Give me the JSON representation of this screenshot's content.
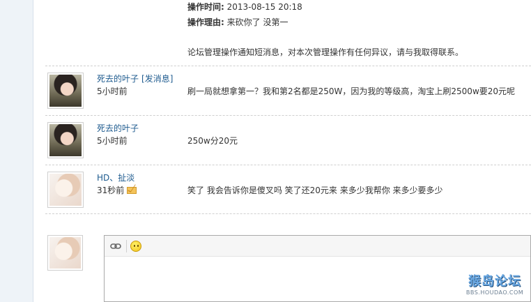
{
  "operation": {
    "time_label": "操作时间:",
    "time_value": "2013-08-15 20:18",
    "reason_label": "操作理由:",
    "reason_value": "来砍你了  没第一",
    "notice": "论坛管理操作通知短消息，对本次管理操作有任何异议，请与我取得联系。"
  },
  "comments": [
    {
      "author": "死去的叶子",
      "send_message": "[发消息]",
      "time": "5小时前",
      "content": "刷一局就想拿第一？我和第2名都是250W，因为我的等级高，淘宝上刷2500w要20元呢",
      "avatar": "girl-avatar"
    },
    {
      "author": "死去的叶子",
      "time": "5小时前",
      "content": "250w分20元",
      "avatar": "girl-avatar"
    },
    {
      "author": "HD、扯淡",
      "time": "31秒前",
      "content": "笑了  我会告诉你是傻叉吗              笑了还20元来  来多少我帮你 来多少要多少",
      "avatar": "doll-avatar",
      "icon": "mail-icon"
    }
  ],
  "editor": {
    "toolbar": [
      "link-icon",
      "smiley-icon"
    ],
    "value": ""
  },
  "watermark": {
    "main": "猴岛论坛",
    "sub": "BBS.HOUDAO.COM"
  },
  "colors": {
    "link": "#1d5a8e",
    "text": "#333333",
    "divider": "#cfcfcf",
    "strip": "#eef3f8"
  }
}
